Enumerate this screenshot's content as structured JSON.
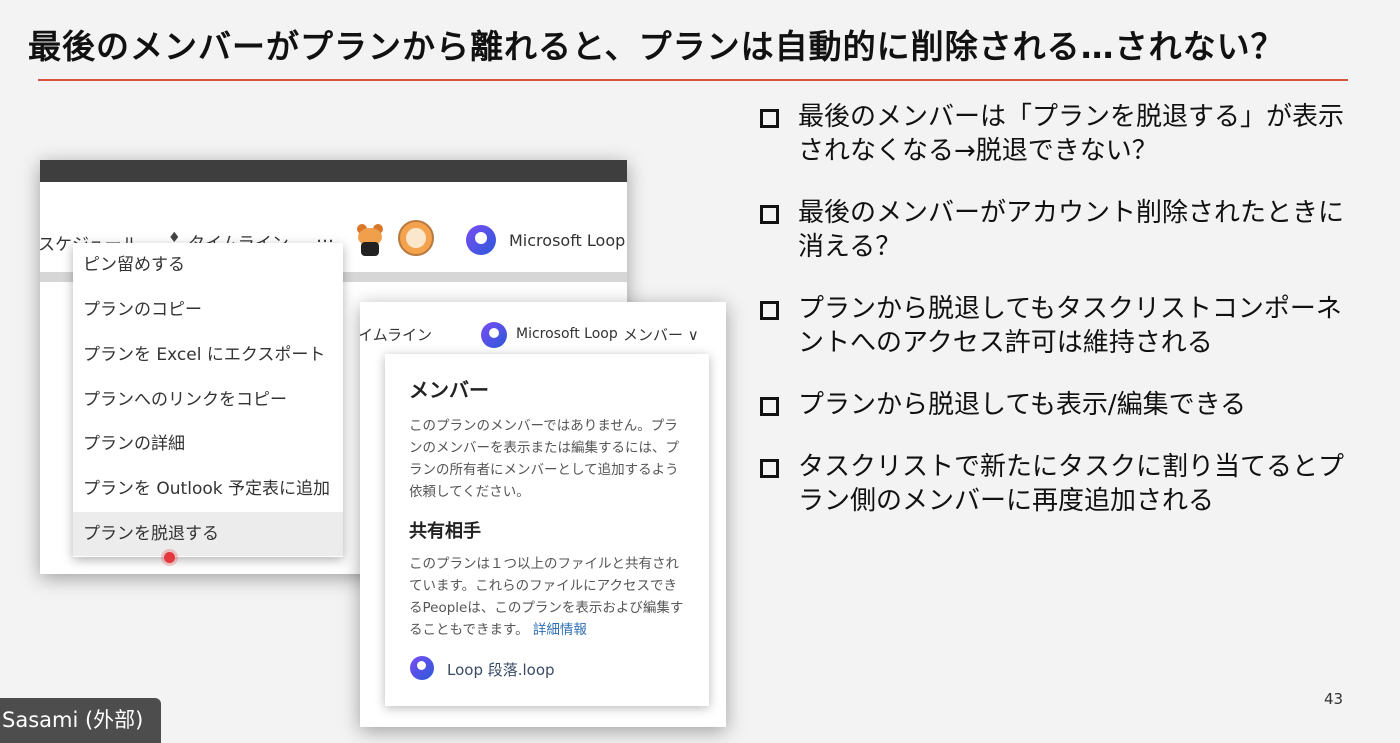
{
  "slide": {
    "title": "最後のメンバーがプランから離れると、プランは自動的に削除される…されない？",
    "page_number": "43",
    "accent_color": "#d9533d"
  },
  "screenshot1": {
    "toolbar": {
      "schedule": "スケジュール",
      "timeline_icon": "diamond-icon",
      "timeline": "タイムライン",
      "more": "…",
      "app": "Microsoft Loop"
    },
    "menu": {
      "items": [
        "ピン留めする",
        "プランのコピー",
        "プランを Excel にエクスポート",
        "プランへのリンクをコピー",
        "プランの詳細",
        "プランを Outlook 予定表に追加",
        "プランを脱退する"
      ],
      "highlighted_index": 6
    }
  },
  "screenshot2": {
    "toolbar": {
      "timeline": "イムライン",
      "app": "Microsoft Loop",
      "members_dropdown": "メンバー ∨"
    },
    "popup": {
      "heading": "メンバー",
      "description": "このプランのメンバーではありません。プランのメンバーを表示または編集するには、プランの所有者にメンバーとして追加するよう依頼してください。",
      "shared_heading": "共有相手",
      "shared_description": "このプランは１つ以上のファイルと共有されています。これらのファイルにアクセスできるPeopleは、このプランを表示および編集することもできます。",
      "details_link": "詳細情報",
      "file_name": "Loop 段落.loop"
    }
  },
  "bullets": [
    "最後のメンバーは「プランを脱退する」が表示されなくなる→脱退できない？",
    "最後のメンバーがアカウント削除されたときに消える？",
    "プランから脱退してもタスクリストコンポーネントへのアクセス許可は維持される",
    "プランから脱退しても表示/編集できる",
    "タスクリストで新たにタスクに割り当てるとプラン側のメンバーに再度追加される"
  ],
  "participant": {
    "name": "Sasami (外部)"
  }
}
